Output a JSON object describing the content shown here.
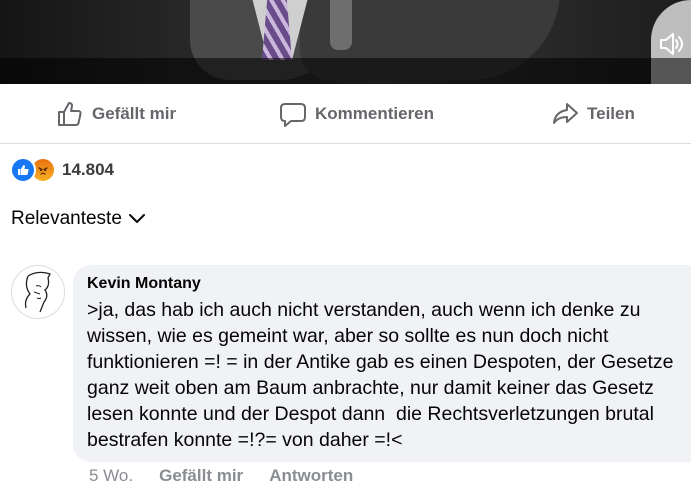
{
  "video": {
    "volume_icon": "volume-icon"
  },
  "actions": {
    "like_label": "Gefällt mir",
    "comment_label": "Kommentieren",
    "share_label": "Teilen"
  },
  "reactions": {
    "icons": [
      "like-icon",
      "angry-icon"
    ],
    "count": "14.804"
  },
  "sort": {
    "label": "Relevanteste",
    "icon": "chevron-down-icon"
  },
  "comment": {
    "author": "Kevin Montany",
    "text": ">ja, das hab ich auch nicht verstanden, auch wenn ich denke zu wissen, wie es gemeint war, aber so sollte es nun doch nicht funktionieren =! = in der Antike gab es einen Despoten, der Gesetze ganz weit oben am Baum anbrachte, nur damit keiner das Gesetz lesen konnte und der Despot dann  die Rechtsverletzungen brutal bestrafen konnte =!?= von daher =!<",
    "time": "5 Wo.",
    "like_label": "Gefällt mir",
    "reply_label": "Antworten"
  },
  "colors": {
    "secondary_text": "#65676b",
    "bubble_bg": "#f0f2f5",
    "like_blue": "#1877f2",
    "angry_orange": "#e9710f"
  }
}
